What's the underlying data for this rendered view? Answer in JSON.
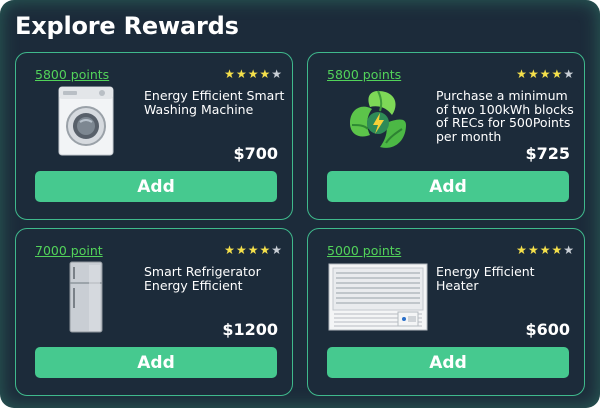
{
  "title": "Explore Rewards",
  "cards": [
    {
      "points": "5800 points",
      "rating": 4,
      "max_rating": 5,
      "description": "Energy Efficient Smart Washing Machine",
      "price": "$700",
      "add_label": "Add",
      "image": "washing-machine-icon"
    },
    {
      "points": "5800 points",
      "rating": 4,
      "max_rating": 5,
      "description": "Purchase a minimum of two 100kWh blocks of RECs for 500Points per month",
      "price": "$725",
      "add_label": "Add",
      "image": "renewable-energy-leaves-icon"
    },
    {
      "points": "7000 point",
      "rating": 4,
      "max_rating": 5,
      "description": "Smart Refrigerator Energy Efficient",
      "price": "$1200",
      "add_label": "Add",
      "image": "refrigerator-icon"
    },
    {
      "points": "5000 points",
      "rating": 4,
      "max_rating": 5,
      "description": "Energy Efficient Heater",
      "price": "$600",
      "add_label": "Add",
      "image": "air-conditioner-heater-icon"
    }
  ],
  "colors": {
    "background": "#1c2b3a",
    "accent": "#46c98f",
    "points_link": "#52d35a",
    "star_on": "#f5e04b",
    "star_off": "#c9cfd6"
  }
}
